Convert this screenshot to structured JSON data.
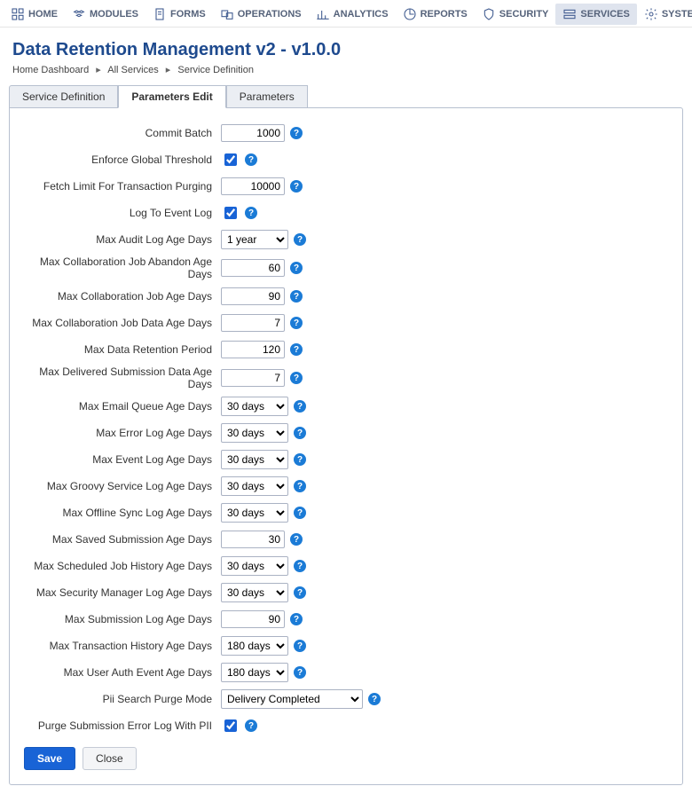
{
  "nav": {
    "home": "HOME",
    "modules": "MODULES",
    "forms": "FORMS",
    "operations": "OPERATIONS",
    "analytics": "ANALYTICS",
    "reports": "REPORTS",
    "security": "SECURITY",
    "services": "SERVICES",
    "system": "SYSTEM"
  },
  "page": {
    "title": "Data Retention Management v2 - v1.0.0"
  },
  "breadcrumb": {
    "a": "Home Dashboard",
    "b": "All Services",
    "c": "Service Definition"
  },
  "tabs": {
    "def": "Service Definition",
    "paramsEdit": "Parameters Edit",
    "params": "Parameters"
  },
  "form": {
    "commitBatch": {
      "label": "Commit Batch",
      "value": "1000"
    },
    "enforceGlobal": {
      "label": "Enforce Global Threshold",
      "checked": true
    },
    "fetchLimit": {
      "label": "Fetch Limit For Transaction Purging",
      "value": "10000"
    },
    "logToEvent": {
      "label": "Log To Event Log",
      "checked": true
    },
    "maxAuditLog": {
      "label": "Max Audit Log Age Days",
      "value": "1 year"
    },
    "maxCollabAbandon": {
      "label": "Max Collaboration Job Abandon Age Days",
      "value": "60"
    },
    "maxCollabAge": {
      "label": "Max Collaboration Job Age Days",
      "value": "90"
    },
    "maxCollabData": {
      "label": "Max Collaboration Job Data Age Days",
      "value": "7"
    },
    "maxDataRetention": {
      "label": "Max Data Retention Period",
      "value": "120"
    },
    "maxDeliveredSub": {
      "label": "Max Delivered Submission Data Age Days",
      "value": "7"
    },
    "maxEmailQueue": {
      "label": "Max Email Queue Age Days",
      "value": "30 days"
    },
    "maxErrorLog": {
      "label": "Max Error Log Age Days",
      "value": "30 days"
    },
    "maxEventLog": {
      "label": "Max Event Log Age Days",
      "value": "30 days"
    },
    "maxGroovy": {
      "label": "Max Groovy Service Log Age Days",
      "value": "30 days"
    },
    "maxOffline": {
      "label": "Max Offline Sync Log Age Days",
      "value": "30 days"
    },
    "maxSavedSub": {
      "label": "Max Saved Submission Age Days",
      "value": "30"
    },
    "maxSchedJob": {
      "label": "Max Scheduled Job History Age Days",
      "value": "30 days"
    },
    "maxSecurity": {
      "label": "Max Security Manager Log Age Days",
      "value": "30 days"
    },
    "maxSubmissionLog": {
      "label": "Max Submission Log Age Days",
      "value": "90"
    },
    "maxTxn": {
      "label": "Max Transaction History Age Days",
      "value": "180 days"
    },
    "maxUserAuth": {
      "label": "Max User Auth Event Age Days",
      "value": "180 days"
    },
    "piiSearch": {
      "label": "Pii Search Purge Mode",
      "value": "Delivery Completed"
    },
    "purgeSubErr": {
      "label": "Purge Submission Error Log With PII",
      "checked": true
    }
  },
  "buttons": {
    "save": "Save",
    "close": "Close"
  },
  "help": "?"
}
